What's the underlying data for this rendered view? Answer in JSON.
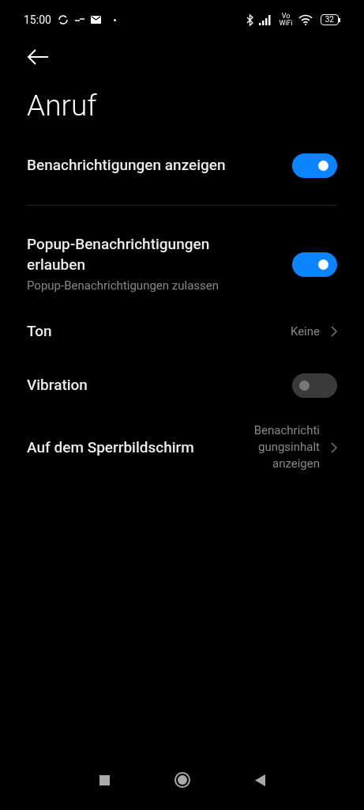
{
  "status_bar": {
    "time": "15:00",
    "volte_label_top": "Vo",
    "volte_label_bottom": "WiFi",
    "battery": "32"
  },
  "title": "Anruf",
  "sections": [
    {
      "rows": [
        {
          "kind": "toggle",
          "label": "Benachrichtigungen anzeigen",
          "on": true
        }
      ]
    },
    {
      "rows": [
        {
          "kind": "toggle",
          "label": "Popup-Benachrichtigungen erlauben",
          "subtitle": "Popup-Benachrichtigungen zulassen",
          "on": true
        },
        {
          "kind": "link",
          "label": "Ton",
          "value_lines": [
            "Keine"
          ]
        },
        {
          "kind": "toggle",
          "label": "Vibration",
          "on": false
        },
        {
          "kind": "link",
          "label": "Auf dem Sperrbildschirm",
          "value_lines": [
            "Benachrichti",
            "gungsinhalt",
            "anzeigen"
          ]
        }
      ]
    }
  ]
}
